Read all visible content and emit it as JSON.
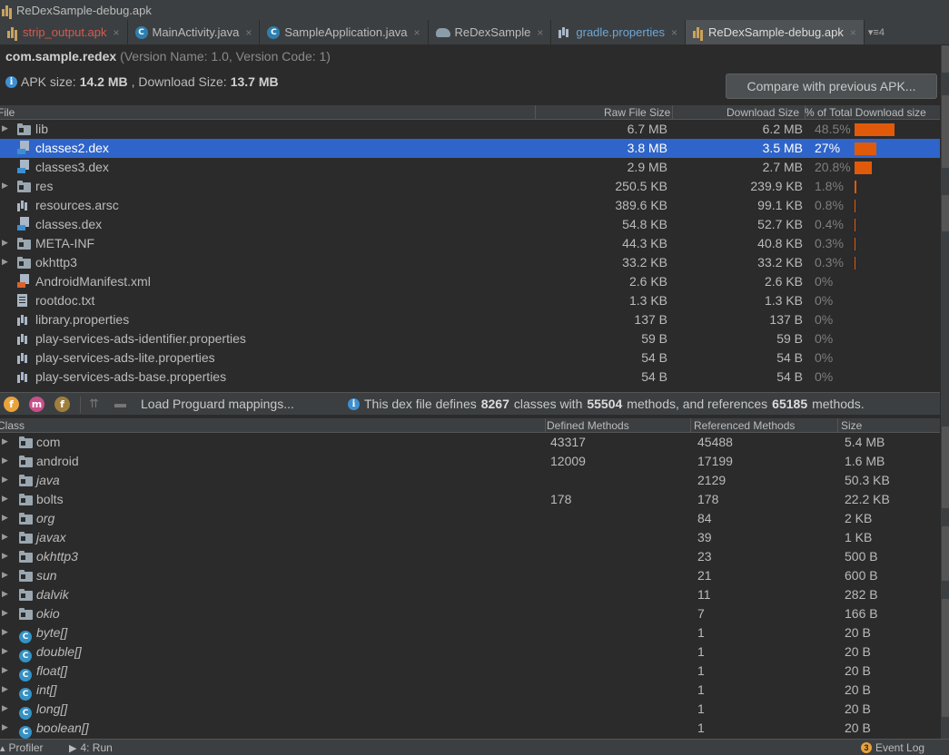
{
  "window": {
    "title": "ReDexSample-debug.apk"
  },
  "tabs": [
    {
      "label": "strip_output.apk",
      "icon": "apk-icon",
      "color": "#d65a4e",
      "active": false
    },
    {
      "label": "MainActivity.java",
      "icon": "class-icon",
      "active": false
    },
    {
      "label": "SampleApplication.java",
      "icon": "class-icon",
      "active": false
    },
    {
      "label": "ReDexSample",
      "icon": "gradle-icon",
      "active": false
    },
    {
      "label": "gradle.properties",
      "icon": "properties-icon",
      "color": "#6ea6d6",
      "active": false
    },
    {
      "label": "ReDexSample-debug.apk",
      "icon": "apk-icon",
      "active": true
    }
  ],
  "tab_overflow": "4",
  "package": {
    "name": "com.sample.redex",
    "version_info": "(Version Name: 1.0, Version Code: 1)"
  },
  "apk_size": {
    "prefix": "APK size:",
    "size": "14.2 MB",
    "mid": ", Download Size:",
    "download": "13.7 MB"
  },
  "compare_button": "Compare with previous APK...",
  "file_table": {
    "headers": {
      "file": "File",
      "raw": "Raw File Size",
      "download": "Download Size",
      "percent": "% of Total Download size"
    },
    "accent": "#e05a0a",
    "rows": [
      {
        "name": "lib",
        "type": "folder",
        "expandable": true,
        "raw": "6.7 MB",
        "download": "6.2 MB",
        "percent": "48.5%",
        "share": 48.5
      },
      {
        "name": "classes2.dex",
        "type": "dex",
        "expandable": false,
        "raw": "3.8 MB",
        "download": "3.5 MB",
        "percent": "27%",
        "share": 27,
        "selected": true
      },
      {
        "name": "classes3.dex",
        "type": "dex",
        "expandable": false,
        "raw": "2.9 MB",
        "download": "2.7 MB",
        "percent": "20.8%",
        "share": 20.8
      },
      {
        "name": "res",
        "type": "folder-res",
        "expandable": true,
        "raw": "250.5 KB",
        "download": "239.9 KB",
        "percent": "1.8%",
        "share": 1.8
      },
      {
        "name": "resources.arsc",
        "type": "props",
        "expandable": false,
        "raw": "389.6 KB",
        "download": "99.1 KB",
        "percent": "0.8%",
        "share": 0.8
      },
      {
        "name": "classes.dex",
        "type": "dex",
        "expandable": false,
        "raw": "54.8 KB",
        "download": "52.7 KB",
        "percent": "0.4%",
        "share": 0.4
      },
      {
        "name": "META-INF",
        "type": "folder",
        "expandable": true,
        "raw": "44.3 KB",
        "download": "40.8 KB",
        "percent": "0.3%",
        "share": 0.3
      },
      {
        "name": "okhttp3",
        "type": "folder",
        "expandable": true,
        "raw": "33.2 KB",
        "download": "33.2 KB",
        "percent": "0.3%",
        "share": 0.3
      },
      {
        "name": "AndroidManifest.xml",
        "type": "xml",
        "expandable": false,
        "raw": "2.6 KB",
        "download": "2.6 KB",
        "percent": "0%",
        "share": 0
      },
      {
        "name": "rootdoc.txt",
        "type": "file",
        "expandable": false,
        "raw": "1.3 KB",
        "download": "1.3 KB",
        "percent": "0%",
        "share": 0
      },
      {
        "name": "library.properties",
        "type": "props",
        "expandable": false,
        "raw": "137 B",
        "download": "137 B",
        "percent": "0%",
        "share": 0
      },
      {
        "name": "play-services-ads-identifier.properties",
        "type": "props",
        "expandable": false,
        "raw": "59 B",
        "download": "59 B",
        "percent": "0%",
        "share": 0
      },
      {
        "name": "play-services-ads-lite.properties",
        "type": "props",
        "expandable": false,
        "raw": "54 B",
        "download": "54 B",
        "percent": "0%",
        "share": 0
      },
      {
        "name": "play-services-ads-base.properties",
        "type": "props",
        "expandable": false,
        "raw": "54 B",
        "download": "54 B",
        "percent": "0%",
        "share": 0
      }
    ]
  },
  "dex_toolbar": {
    "filter_buttons": [
      {
        "glyph": "f",
        "color": "#e8a33b"
      },
      {
        "glyph": "m",
        "color": "#c8508a"
      },
      {
        "glyph": "f",
        "color": "#a07f3c"
      }
    ],
    "proguard": "Load Proguard mappings...",
    "info": {
      "prefix": "This dex file defines",
      "classes": "8267",
      "mid1": "classes with",
      "methods": "55504",
      "mid2": "methods, and references",
      "refs": "65185",
      "suffix": "methods."
    }
  },
  "class_table": {
    "headers": {
      "class": "Class",
      "defined": "Defined Methods",
      "referenced": "Referenced Methods",
      "size": "Size"
    },
    "rows": [
      {
        "name": "com",
        "type": "package",
        "italic": false,
        "defined": "43317",
        "referenced": "45488",
        "size": "5.4 MB"
      },
      {
        "name": "android",
        "type": "package",
        "italic": false,
        "defined": "12009",
        "referenced": "17199",
        "size": "1.6 MB"
      },
      {
        "name": "java",
        "type": "package",
        "italic": true,
        "defined": "",
        "referenced": "2129",
        "size": "50.3 KB"
      },
      {
        "name": "bolts",
        "type": "package",
        "italic": false,
        "defined": "178",
        "referenced": "178",
        "size": "22.2 KB"
      },
      {
        "name": "org",
        "type": "package",
        "italic": true,
        "defined": "",
        "referenced": "84",
        "size": "2 KB"
      },
      {
        "name": "javax",
        "type": "package",
        "italic": true,
        "defined": "",
        "referenced": "39",
        "size": "1 KB"
      },
      {
        "name": "okhttp3",
        "type": "package",
        "italic": true,
        "defined": "",
        "referenced": "23",
        "size": "500 B"
      },
      {
        "name": "sun",
        "type": "package",
        "italic": true,
        "defined": "",
        "referenced": "21",
        "size": "600 B"
      },
      {
        "name": "dalvik",
        "type": "package",
        "italic": true,
        "defined": "",
        "referenced": "11",
        "size": "282 B"
      },
      {
        "name": "okio",
        "type": "package",
        "italic": true,
        "defined": "",
        "referenced": "7",
        "size": "166 B"
      },
      {
        "name": "byte[]",
        "type": "class",
        "italic": true,
        "defined": "",
        "referenced": "1",
        "size": "20 B"
      },
      {
        "name": "double[]",
        "type": "class",
        "italic": true,
        "defined": "",
        "referenced": "1",
        "size": "20 B"
      },
      {
        "name": "float[]",
        "type": "class",
        "italic": true,
        "defined": "",
        "referenced": "1",
        "size": "20 B"
      },
      {
        "name": "int[]",
        "type": "class",
        "italic": true,
        "defined": "",
        "referenced": "1",
        "size": "20 B"
      },
      {
        "name": "long[]",
        "type": "class",
        "italic": true,
        "defined": "",
        "referenced": "1",
        "size": "20 B"
      },
      {
        "name": "boolean[]",
        "type": "class",
        "italic": true,
        "defined": "",
        "referenced": "1",
        "size": "20 B"
      }
    ]
  },
  "status_bar": {
    "profiler": "Profiler",
    "run": "4: Run",
    "event_count": "3",
    "event_log": "Event Log"
  }
}
